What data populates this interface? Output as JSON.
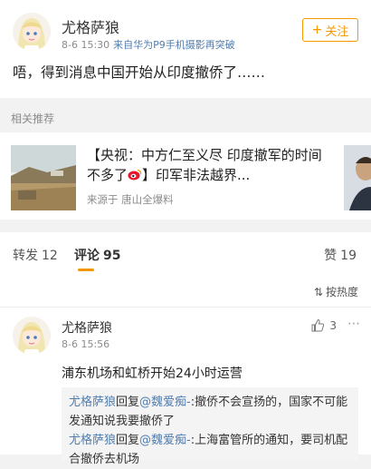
{
  "post": {
    "username": "尤格萨狼",
    "time": "8-6 15:30",
    "source": "来自华为P9手机摄影再突破",
    "follow_label": "关注",
    "content": "唔，得到消息中国开始从印度撤侨了……"
  },
  "related": {
    "section_label": "相关推荐",
    "title_part1": "【央视：中方仁至义尽 印度撤军的时间不多了",
    "title_part2": "】印军非法越界...",
    "source": "来源于 唐山全爆料"
  },
  "tabs": {
    "repost_label": "转发",
    "repost_count": "12",
    "comments_label": "评论",
    "comments_count": "95",
    "likes_label": "赞",
    "likes_count": "19"
  },
  "sort_label": "按热度",
  "comment": {
    "username": "尤格萨狼",
    "time": "8-6 15:56",
    "likes": "3",
    "content": "浦东机场和虹桥开始24小时运营",
    "replies": [
      {
        "user": "尤格萨狼",
        "verb": "回复",
        "target": "@魏爱痴-",
        "text": ":撤侨不会宣扬的，国家不可能发通知说我要撤侨了"
      },
      {
        "user": "尤格萨狼",
        "verb": "回复",
        "target": "@魏爱痴-",
        "text": ":上海富管所的通知，要司机配合撤侨去机场"
      }
    ]
  },
  "colors": {
    "accent": "#f39800",
    "link": "#507daf",
    "meta": "#8b8b8b"
  }
}
